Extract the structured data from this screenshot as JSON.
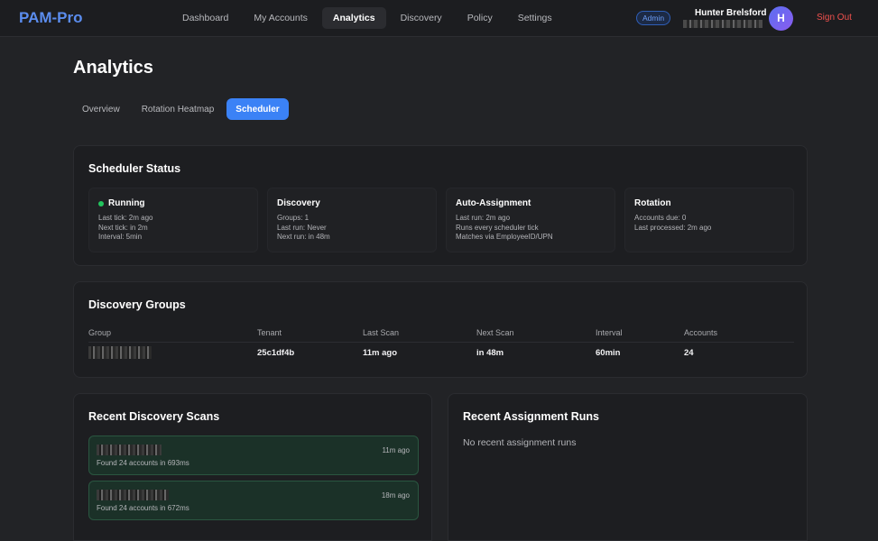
{
  "nav": {
    "brand": "PAM-Pro",
    "links": [
      "Dashboard",
      "My Accounts",
      "Analytics",
      "Discovery",
      "Policy",
      "Settings"
    ],
    "badge": "Admin",
    "user_name": "Hunter Brelsford",
    "avatar_initial": "H",
    "signout": "Sign Out"
  },
  "page": {
    "title": "Analytics",
    "tabs": [
      "Overview",
      "Rotation Heatmap",
      "Scheduler"
    ]
  },
  "scheduler": {
    "title": "Scheduler Status",
    "boxes": [
      {
        "head": "Running",
        "lines": [
          "Last tick: 2m ago",
          "Next tick: in 2m",
          "Interval: 5min"
        ]
      },
      {
        "head": "Discovery",
        "lines": [
          "Groups: 1",
          "Last run: Never",
          "Next run: in 48m"
        ]
      },
      {
        "head": "Auto-Assignment",
        "lines": [
          "Last run: 2m ago",
          "Runs every scheduler tick",
          "Matches via EmployeeID/UPN"
        ]
      },
      {
        "head": "Rotation",
        "lines": [
          "Accounts due: 0",
          "Last processed: 2m ago"
        ]
      }
    ]
  },
  "groups": {
    "title": "Discovery Groups",
    "headers": [
      "Group",
      "Tenant",
      "Last Scan",
      "Next Scan",
      "Interval",
      "Accounts"
    ],
    "row": [
      "",
      "25c1df4b",
      "11m ago",
      "in 48m",
      "60min",
      "24"
    ]
  },
  "scans": {
    "title": "Recent Discovery Scans",
    "items": [
      {
        "when": "11m ago",
        "msg": "Found 24 accounts in 693ms"
      },
      {
        "when": "18m ago",
        "msg": "Found 24 accounts in 672ms"
      }
    ]
  },
  "assignments": {
    "title": "Recent Assignment Runs",
    "empty": "No recent assignment runs"
  },
  "colors": {
    "accent": "#3b82f6",
    "running": "#22c55e",
    "signout": "#f0514d"
  }
}
